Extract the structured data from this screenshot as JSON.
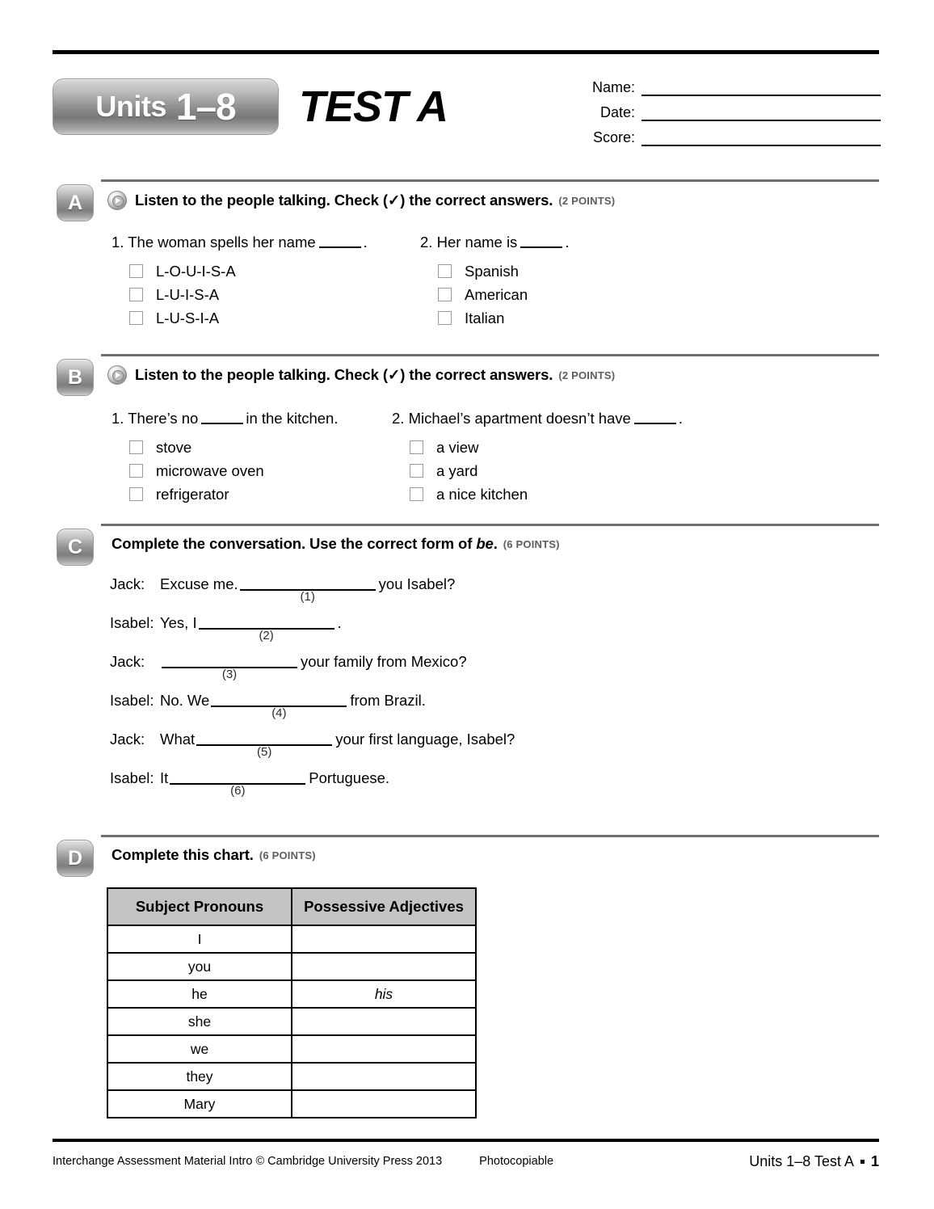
{
  "header": {
    "units_label": "Units",
    "units_range": "1–8",
    "test_title": "TEST A"
  },
  "id_fields": [
    {
      "label": "Name:"
    },
    {
      "label": "Date:"
    },
    {
      "label": "Score:"
    }
  ],
  "sections": [
    {
      "letter": "A",
      "icon": "audio-play-icon",
      "instruction": "Listen to the people talking. Check (✓) the correct answers.",
      "points": "(2 POINTS)",
      "questions": [
        {
          "number": "1.",
          "stem_before": "The woman spells her name",
          "stem_after": ".",
          "options": [
            "L-O-U-I-S-A",
            "L-U-I-S-A",
            "L-U-S-I-A"
          ]
        },
        {
          "number": "2.",
          "stem_before": "Her name is",
          "stem_after": ".",
          "options": [
            "Spanish",
            "American",
            "Italian"
          ]
        }
      ]
    },
    {
      "letter": "B",
      "icon": "audio-play-icon",
      "instruction": "Listen to the people talking. Check (✓) the correct answers.",
      "points": "(2 POINTS)",
      "questions": [
        {
          "number": "1.",
          "stem_before": "There’s no",
          "stem_after": "in the kitchen.",
          "options": [
            "stove",
            "microwave oven",
            "refrigerator"
          ]
        },
        {
          "number": "2.",
          "stem_before": "Michael’s apartment doesn’t have",
          "stem_after": ".",
          "options": [
            "a view",
            "a yard",
            "a nice kitchen"
          ]
        }
      ]
    },
    {
      "letter": "C",
      "instruction_pre": "Complete the conversation. Use the correct form of ",
      "instruction_italic": "be",
      "instruction_post": ".",
      "points": "(6 POINTS)",
      "conversation": [
        {
          "speaker": "Jack:",
          "before": "Excuse me.",
          "blank": "(1)",
          "after": "you Isabel?"
        },
        {
          "speaker": "Isabel:",
          "before": "Yes, I",
          "blank": "(2)",
          "after": "."
        },
        {
          "speaker": "Jack:",
          "before": "",
          "blank": "(3)",
          "after": "your family from Mexico?"
        },
        {
          "speaker": "Isabel:",
          "before": "No. We",
          "blank": "(4)",
          "after": "from Brazil."
        },
        {
          "speaker": "Jack:",
          "before": "What",
          "blank": "(5)",
          "after": "your first language, Isabel?"
        },
        {
          "speaker": "Isabel:",
          "before": "It",
          "blank": "(6)",
          "after": "Portuguese."
        }
      ]
    },
    {
      "letter": "D",
      "instruction": "Complete this chart.",
      "points": "(6 POINTS)",
      "table": {
        "headers": [
          "Subject Pronouns",
          "Possessive Adjectives"
        ],
        "rows": [
          {
            "pronoun": "I",
            "possessive": ""
          },
          {
            "pronoun": "you",
            "possessive": ""
          },
          {
            "pronoun": "he",
            "possessive": "his"
          },
          {
            "pronoun": "she",
            "possessive": ""
          },
          {
            "pronoun": "we",
            "possessive": ""
          },
          {
            "pronoun": "they",
            "possessive": ""
          },
          {
            "pronoun": "Mary",
            "possessive": ""
          }
        ]
      }
    }
  ],
  "footer": {
    "copyright": "Interchange Assessment Material Intro © Cambridge University Press 2013",
    "photocopiable": "Photocopiable",
    "right_label": "Units 1–8 Test A",
    "page_number": "1"
  }
}
